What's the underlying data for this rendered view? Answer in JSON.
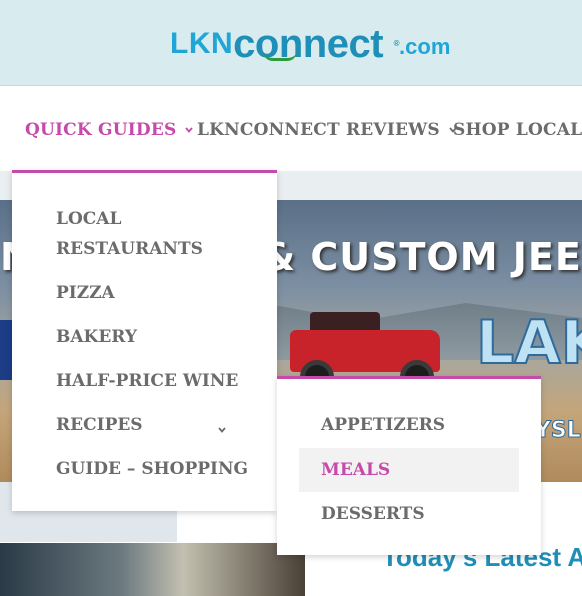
{
  "header": {
    "logo": {
      "lkn": "LKN",
      "connect": "connect",
      "dotcom": ".com",
      "reg": "®"
    }
  },
  "nav": {
    "items": [
      {
        "label": "QUICK GUIDES",
        "active": true
      },
      {
        "label": "LKNCONNECT REVIEWS",
        "active": false
      },
      {
        "label": "SHOP LOCAL",
        "active": false
      }
    ]
  },
  "dropdown": {
    "items": [
      {
        "label": "LOCAL RESTAURANTS"
      },
      {
        "label": "PIZZA"
      },
      {
        "label": "BAKERY"
      },
      {
        "label": "HALF-PRICE WINE"
      },
      {
        "label": "RECIPES",
        "has_submenu": true
      },
      {
        "label": "GUIDE – SHOPPING"
      }
    ]
  },
  "submenu": {
    "items": [
      {
        "label": "APPETIZERS",
        "active": false
      },
      {
        "label": "MEALS",
        "active": true
      },
      {
        "label": "DESSERTS",
        "active": false
      }
    ]
  },
  "hero": {
    "title": "& CUSTOM JEEPS I",
    "left_text": "N",
    "lake": "LAK",
    "sub": "YSL"
  },
  "latest": {
    "heading": "Today's Latest A"
  },
  "colors": {
    "accent": "#c54aa9",
    "nav_text": "#6b6b6b",
    "header_bg": "#d8ecef",
    "brand_blue": "#1f8fb8"
  }
}
